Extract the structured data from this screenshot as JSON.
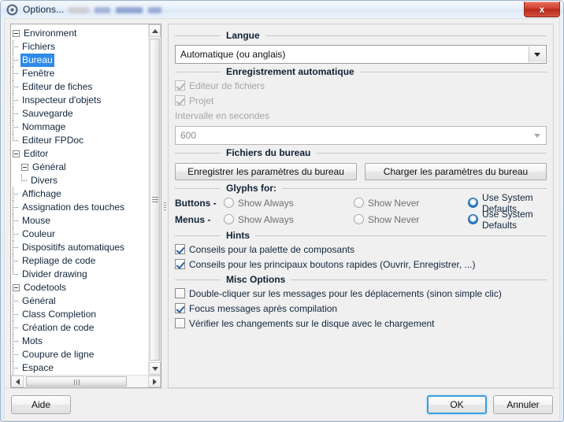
{
  "window": {
    "title": "Options...",
    "icon": "gear-icon",
    "close_label": "x",
    "redacted_title_suffix": true
  },
  "tree": {
    "items": [
      {
        "label": "Environment",
        "depth": 0,
        "expander": true,
        "selected": false
      },
      {
        "label": "Fichiers",
        "depth": 1,
        "expander": false,
        "selected": false
      },
      {
        "label": "Bureau",
        "depth": 1,
        "expander": false,
        "selected": true
      },
      {
        "label": "Fenêtre",
        "depth": 1,
        "expander": false,
        "selected": false
      },
      {
        "label": "Editeur de fiches",
        "depth": 1,
        "expander": false,
        "selected": false
      },
      {
        "label": "Inspecteur d'objets",
        "depth": 1,
        "expander": false,
        "selected": false
      },
      {
        "label": "Sauvegarde",
        "depth": 1,
        "expander": false,
        "selected": false
      },
      {
        "label": "Nommage",
        "depth": 1,
        "expander": false,
        "selected": false
      },
      {
        "label": "Editeur FPDoc",
        "depth": 1,
        "expander": false,
        "selected": false,
        "last": true
      },
      {
        "label": "Editor",
        "depth": 0,
        "expander": true,
        "selected": false
      },
      {
        "label": "Général",
        "depth": 1,
        "expander": true,
        "selected": false
      },
      {
        "label": "Divers",
        "depth": 2,
        "expander": false,
        "selected": false,
        "last": true
      },
      {
        "label": "Affichage",
        "depth": 1,
        "expander": false,
        "selected": false
      },
      {
        "label": "Assignation des touches",
        "depth": 1,
        "expander": false,
        "selected": false
      },
      {
        "label": "Mouse",
        "depth": 1,
        "expander": false,
        "selected": false
      },
      {
        "label": "Couleur",
        "depth": 1,
        "expander": false,
        "selected": false
      },
      {
        "label": "Dispositifs automatiques",
        "depth": 1,
        "expander": false,
        "selected": false
      },
      {
        "label": "Repliage de code",
        "depth": 1,
        "expander": false,
        "selected": false
      },
      {
        "label": "Divider drawing",
        "depth": 1,
        "expander": false,
        "selected": false,
        "last": true
      },
      {
        "label": "Codetools",
        "depth": 0,
        "expander": true,
        "selected": false
      },
      {
        "label": "Général",
        "depth": 1,
        "expander": false,
        "selected": false
      },
      {
        "label": "Class Completion",
        "depth": 1,
        "expander": false,
        "selected": false
      },
      {
        "label": "Création de code",
        "depth": 1,
        "expander": false,
        "selected": false
      },
      {
        "label": "Mots",
        "depth": 1,
        "expander": false,
        "selected": false
      },
      {
        "label": "Coupure de ligne",
        "depth": 1,
        "expander": false,
        "selected": false
      },
      {
        "label": "Espace",
        "depth": 1,
        "expander": false,
        "selected": false
      }
    ]
  },
  "panel": {
    "langue": {
      "title": "Langue",
      "value": "Automatique (ou anglais)"
    },
    "autosave": {
      "title": "Enregistrement automatique",
      "editor_label": "Editeur de fichiers",
      "editor_checked": true,
      "project_label": "Projet",
      "project_checked": true,
      "interval_label": "Intervalle en secondes",
      "interval_value": "600"
    },
    "desktop_files": {
      "title": "Fichiers du bureau",
      "save_button": "Enregistrer les paramètres du bureau",
      "load_button": "Charger les paramètres du bureau"
    },
    "glyphs": {
      "title": "Glyphs for:",
      "buttons_label": "Buttons -",
      "menus_label": "Menus -",
      "option_always": "Show Always",
      "option_never": "Show Never",
      "option_system": "Use System Defaults",
      "buttons_selected": "Use System Defaults",
      "menus_selected": "Use System Defaults"
    },
    "hints": {
      "title": "Hints",
      "items": [
        {
          "label": "Conseils pour la palette de composants",
          "checked": true
        },
        {
          "label": "Conseils pour les principaux boutons rapides (Ouvrir, Enregistrer, ...)",
          "checked": true
        }
      ]
    },
    "misc": {
      "title": "Misc Options",
      "items": [
        {
          "label": "Double-cliquer sur les messages pour les déplacements (sinon simple clic)",
          "checked": false
        },
        {
          "label": "Focus messages après compilation",
          "checked": true
        },
        {
          "label": "Vérifier les changements sur le disque avec le chargement",
          "checked": false
        }
      ]
    }
  },
  "footer": {
    "help_label": "Aide",
    "ok_label": "OK",
    "cancel_label": "Annuler"
  },
  "colors": {
    "selection": "#2f8ae8",
    "radio_accent": "#2b7bc6",
    "check_accent": "#2a5fa8",
    "close_button": "#d04330",
    "default_focus": "#3aa0e0"
  }
}
